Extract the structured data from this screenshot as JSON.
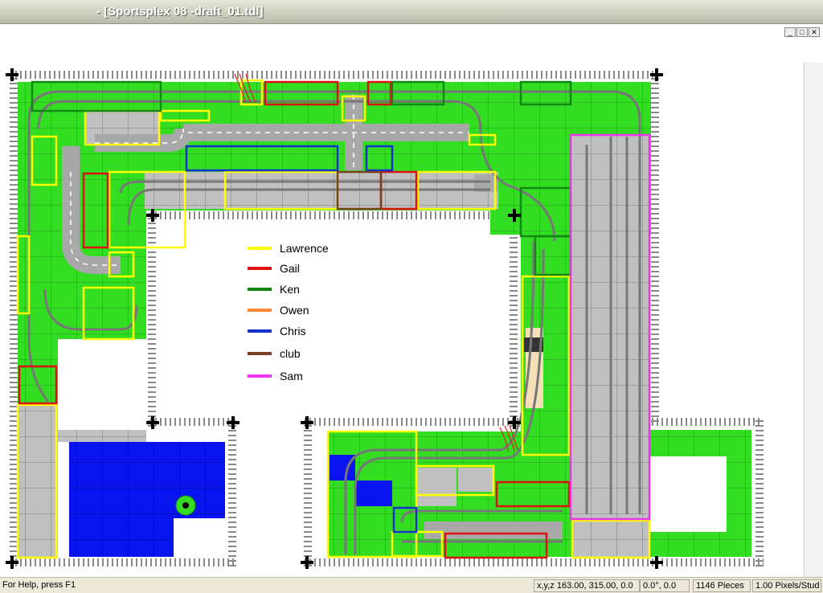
{
  "window": {
    "title": "- [Sportsplex 08 -draft_01.tdl]",
    "buttons": [
      "_",
      "□",
      "✕"
    ]
  },
  "legend": {
    "items": [
      {
        "name": "Lawrence",
        "color": "#ffff00"
      },
      {
        "name": "Gail",
        "color": "#dd1111"
      },
      {
        "name": "Ken",
        "color": "#118811"
      },
      {
        "name": "Owen",
        "color": "#ff8833"
      },
      {
        "name": "Chris",
        "color": "#1133cc"
      },
      {
        "name": "club",
        "color": "#7a4020"
      },
      {
        "name": "Sam",
        "color": "#ee33ee"
      }
    ]
  },
  "colors": {
    "baseplate_green": "#33dd22",
    "baseplate_gray": "#c0c0c0",
    "baseplate_blue": "#0a14ee",
    "road_gray": "#a8a8a8",
    "track": "#888888"
  },
  "status": {
    "help": "For Help, press F1",
    "coords": "x,y,z 163.00, 315.00, 0.0",
    "angle": "0.0°, 0.0",
    "pieces": "1146 Pieces",
    "scale": "1.00 Pixels/Stud"
  }
}
